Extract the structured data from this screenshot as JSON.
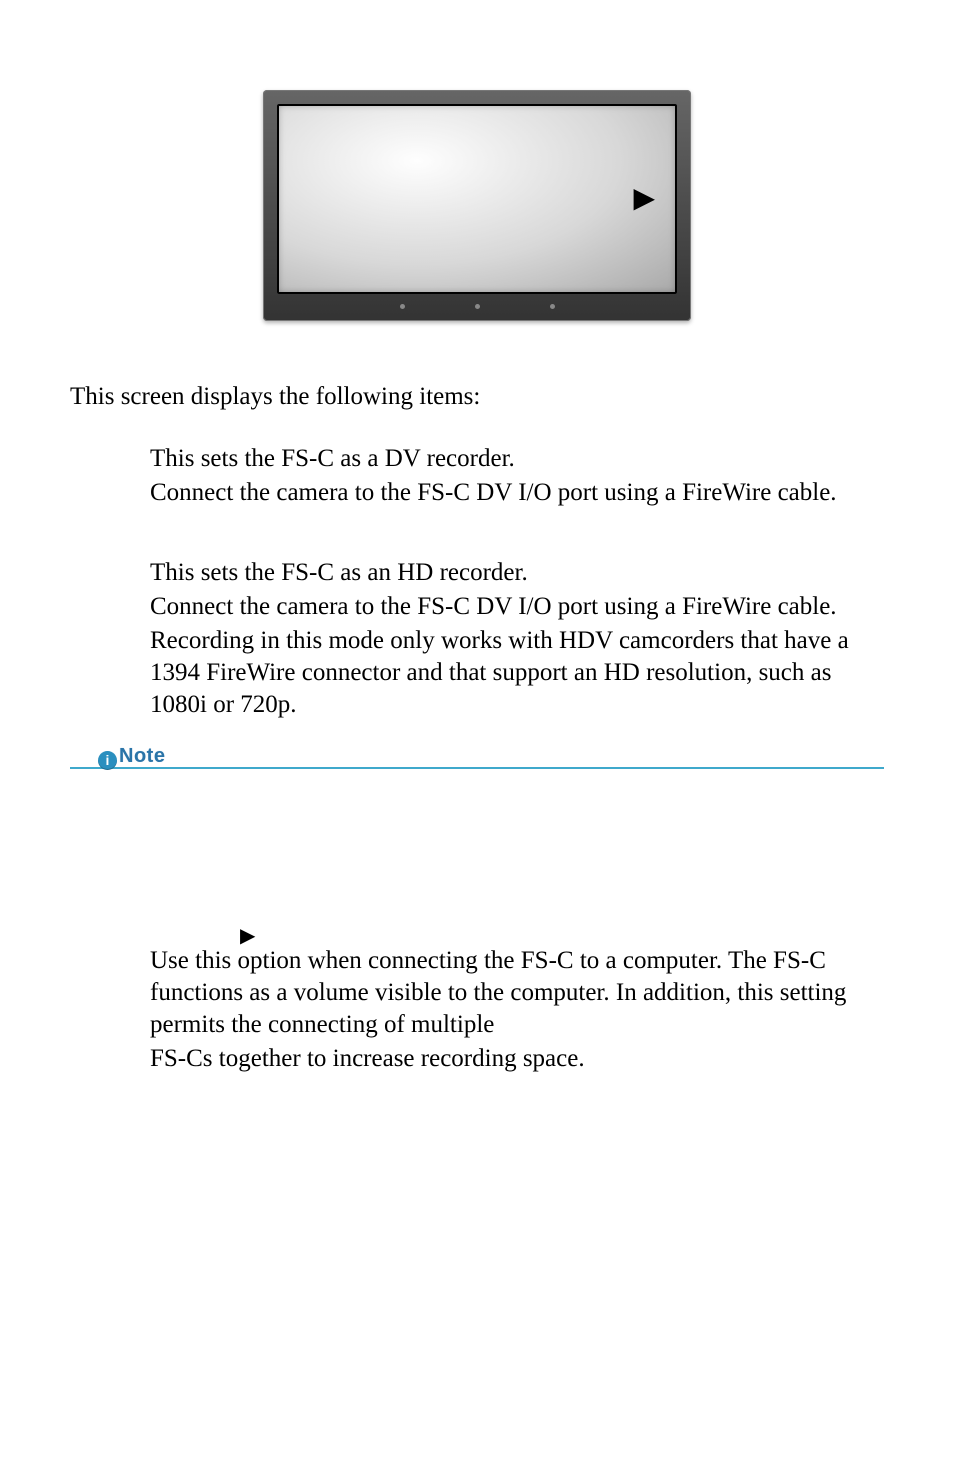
{
  "intro": "This screen displays the following items:",
  "dv": {
    "l1": "This sets the FS-C as a DV recorder.",
    "l2": "Connect the camera to the FS-C DV I/O port using a FireWire cable."
  },
  "hd": {
    "l1": "This sets the FS-C as an HD recorder.",
    "l2": "Connect the camera to the FS-C DV I/O port using a FireWire cable.",
    "l3": "Recording in this mode only works with HDV camcorders that have a 1394 FireWire connector and that support an HD resolution, such as 1080i or 720p."
  },
  "note_label": "Note",
  "note_badge": "i",
  "volume": {
    "l1": "Use this option when connecting the FS-C to a computer. The FS-C functions as a volume visible to the computer.  In addition, this setting permits the connecting of multiple",
    "l2": "FS-Cs together to increase recording space."
  },
  "icons": {
    "device_play": "play-triangle-icon",
    "section_arrow": "play-triangle-icon"
  }
}
